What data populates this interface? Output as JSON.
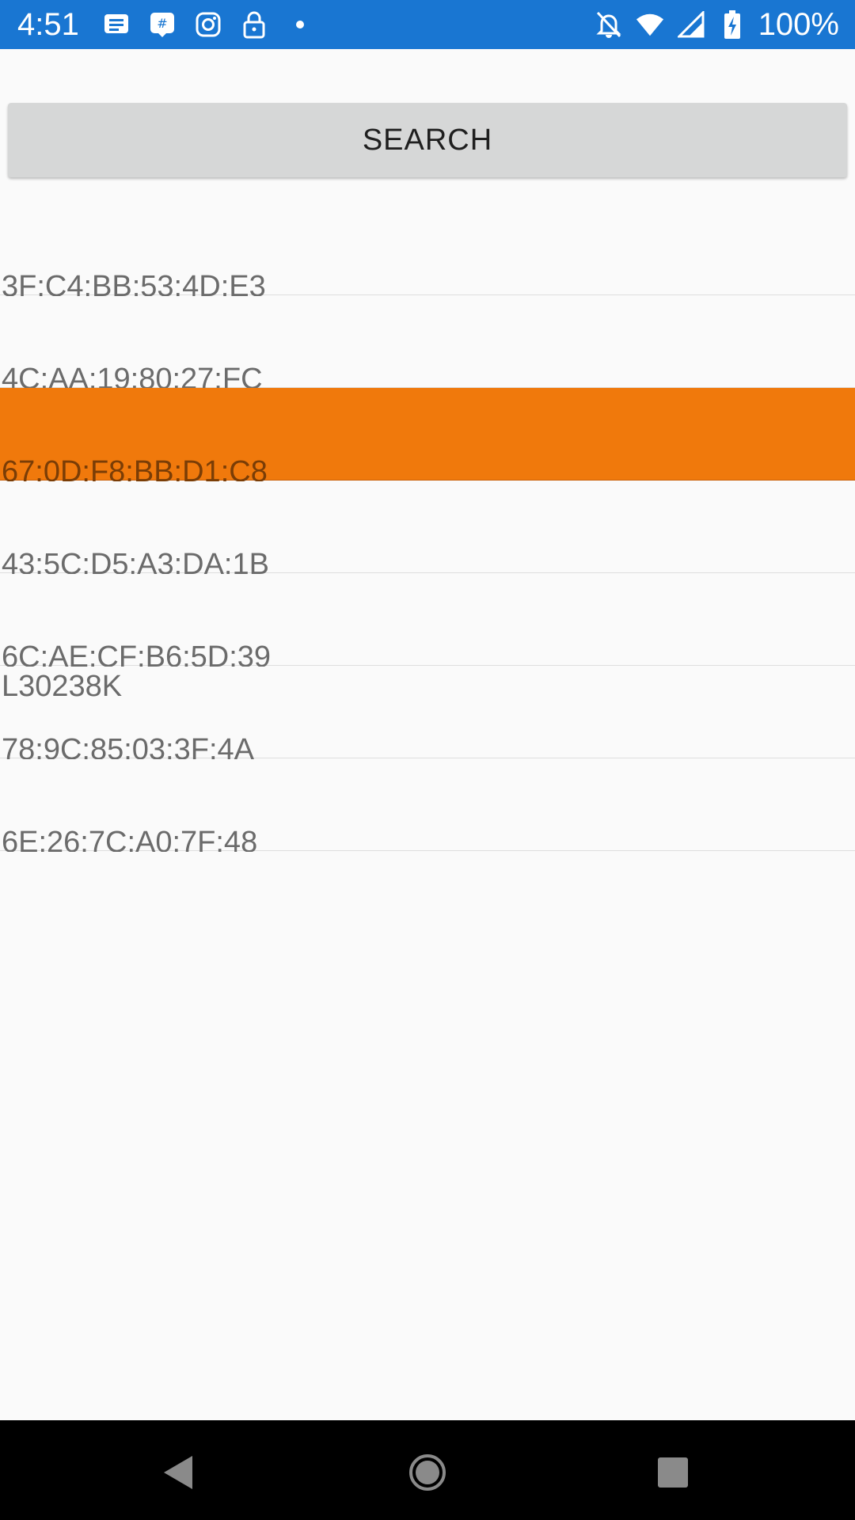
{
  "status_bar": {
    "time": "4:51",
    "battery_text": "100%",
    "left_icons": [
      "message-icon",
      "slack-icon",
      "instagram-icon",
      "lock-icon",
      "dot-icon"
    ],
    "right_icons": [
      "notifications-off-icon",
      "wifi-icon",
      "cell-signal-icon",
      "battery-charging-icon"
    ],
    "background_color": "#1976d2"
  },
  "search_button": {
    "label": "SEARCH"
  },
  "devices": [
    {
      "name": "",
      "address": "3F:C4:BB:53:4D:E3",
      "selected": false
    },
    {
      "name": "",
      "address": "4C:AA:19:80:27:FC",
      "selected": false
    },
    {
      "name": "",
      "address": "67:0D:F8:BB:D1:C8",
      "selected": true
    },
    {
      "name": "",
      "address": "43:5C:D5:A3:DA:1B",
      "selected": false
    },
    {
      "name": "",
      "address": "6C:AE:CF:B6:5D:39",
      "selected": false
    },
    {
      "name": "L30238K",
      "address": "78:9C:85:03:3F:4A",
      "selected": false
    },
    {
      "name": "",
      "address": "6E:26:7C:A0:7F:48",
      "selected": false
    }
  ],
  "selected_color": "#f0790c",
  "nav_bar": {
    "icons": [
      "back-icon",
      "home-icon",
      "recents-icon"
    ]
  }
}
